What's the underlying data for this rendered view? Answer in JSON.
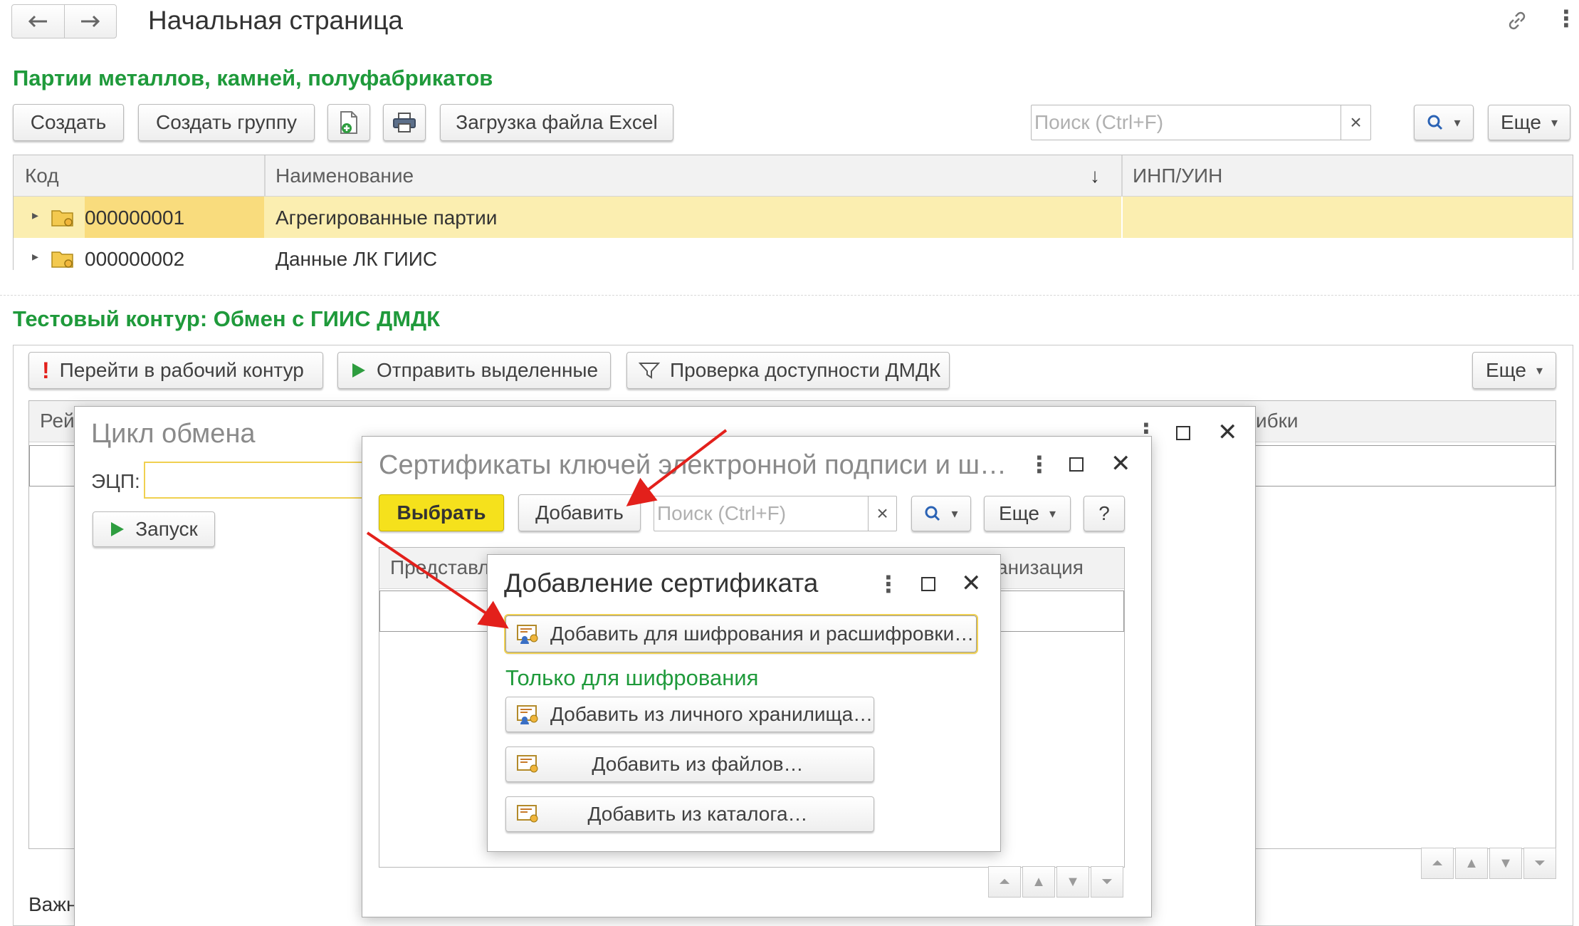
{
  "header": {
    "back_icon": "arrow-left-icon",
    "forward_icon": "arrow-right-icon",
    "title": "Начальная страница",
    "link_icon": "link-icon",
    "menu_icon": "vertical-dots-icon"
  },
  "batches": {
    "title": "Партии металлов, камней, полуфабрикатов",
    "toolbar": {
      "create": "Создать",
      "create_group": "Создать группу",
      "excel": "Загрузка файла Excel",
      "search_placeholder": "Поиск (Ctrl+F)",
      "clear": "×",
      "more": "Еще"
    },
    "columns": {
      "code": "Код",
      "name": "Наименование",
      "sort": "↓",
      "inn": "ИНП/УИН"
    },
    "rows": [
      {
        "code": "000000001",
        "name": "Агрегированные партии"
      },
      {
        "code": "000000002",
        "name": "Данные ЛК ГИИС"
      }
    ]
  },
  "test": {
    "title": "Тестовый контур: Обмен с ГИИС ДМДК",
    "toolbar": {
      "work": "Перейти в рабочий контур",
      "send": "Отправить выделенные",
      "check": "Проверка доступности ДМДК",
      "more": "Еще"
    },
    "col_left": "Рей",
    "col_right": "ибки",
    "footer": "Важн"
  },
  "cycle": {
    "title": "Цикл обмена",
    "ecp_label": "ЭЦП:",
    "run": "Запуск"
  },
  "certs": {
    "title": "Сертификаты ключей электронной подписи и ш…",
    "choose": "Выбрать",
    "add": "Добавить",
    "search_placeholder": "Поиск (Ctrl+F)",
    "clear": "×",
    "more": "Еще",
    "help": "?",
    "col_left": "Представл",
    "col_right": "анизация"
  },
  "add_cert": {
    "title": "Добавление сертификата",
    "encrypt_decrypt": "Добавить для шифрования и расшифровки…",
    "section": "Только для шифрования",
    "from_storage": "Добавить из личного хранилища…",
    "from_files": "Добавить из файлов…",
    "from_catalog": "Добавить из каталога…"
  },
  "colors": {
    "accent_green": "#1f9a3b",
    "highlight_row": "#fbeeb0",
    "primary_button": "#f5e11c",
    "arrow_red": "#e3201b"
  }
}
